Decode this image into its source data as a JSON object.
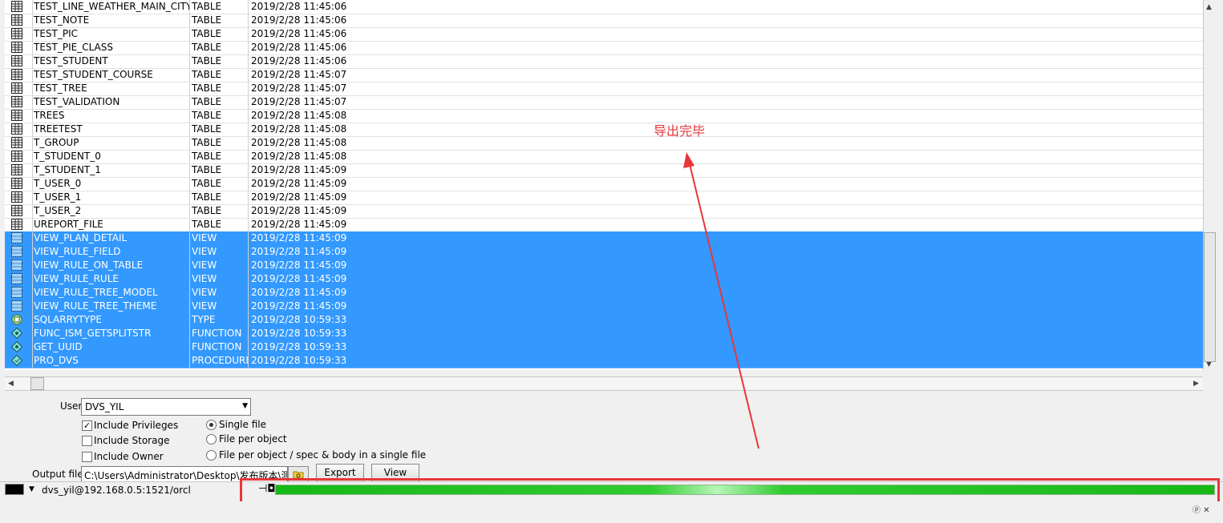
{
  "rows": [
    {
      "name": "TEST_LINE_WEATHER_MAIN_CITY",
      "type": "TABLE",
      "date": "2019/2/28 11:45:06",
      "icon": "table-icon",
      "selected": false
    },
    {
      "name": "TEST_NOTE",
      "type": "TABLE",
      "date": "2019/2/28 11:45:06",
      "icon": "table-icon",
      "selected": false
    },
    {
      "name": "TEST_PIC",
      "type": "TABLE",
      "date": "2019/2/28 11:45:06",
      "icon": "table-icon",
      "selected": false
    },
    {
      "name": "TEST_PIE_CLASS",
      "type": "TABLE",
      "date": "2019/2/28 11:45:06",
      "icon": "table-icon",
      "selected": false
    },
    {
      "name": "TEST_STUDENT",
      "type": "TABLE",
      "date": "2019/2/28 11:45:06",
      "icon": "table-icon",
      "selected": false
    },
    {
      "name": "TEST_STUDENT_COURSE",
      "type": "TABLE",
      "date": "2019/2/28 11:45:07",
      "icon": "table-icon",
      "selected": false
    },
    {
      "name": "TEST_TREE",
      "type": "TABLE",
      "date": "2019/2/28 11:45:07",
      "icon": "table-icon",
      "selected": false
    },
    {
      "name": "TEST_VALIDATION",
      "type": "TABLE",
      "date": "2019/2/28 11:45:07",
      "icon": "table-icon",
      "selected": false
    },
    {
      "name": "TREES",
      "type": "TABLE",
      "date": "2019/2/28 11:45:08",
      "icon": "table-icon",
      "selected": false
    },
    {
      "name": "TREETEST",
      "type": "TABLE",
      "date": "2019/2/28 11:45:08",
      "icon": "table-icon",
      "selected": false
    },
    {
      "name": "T_GROUP",
      "type": "TABLE",
      "date": "2019/2/28 11:45:08",
      "icon": "table-icon",
      "selected": false
    },
    {
      "name": "T_STUDENT_0",
      "type": "TABLE",
      "date": "2019/2/28 11:45:08",
      "icon": "table-icon",
      "selected": false
    },
    {
      "name": "T_STUDENT_1",
      "type": "TABLE",
      "date": "2019/2/28 11:45:09",
      "icon": "table-icon",
      "selected": false
    },
    {
      "name": "T_USER_0",
      "type": "TABLE",
      "date": "2019/2/28 11:45:09",
      "icon": "table-icon",
      "selected": false
    },
    {
      "name": "T_USER_1",
      "type": "TABLE",
      "date": "2019/2/28 11:45:09",
      "icon": "table-icon",
      "selected": false
    },
    {
      "name": "T_USER_2",
      "type": "TABLE",
      "date": "2019/2/28 11:45:09",
      "icon": "table-icon",
      "selected": false
    },
    {
      "name": "UREPORT_FILE",
      "type": "TABLE",
      "date": "2019/2/28 11:45:09",
      "icon": "table-icon",
      "selected": false
    },
    {
      "name": "VIEW_PLAN_DETAIL",
      "type": "VIEW",
      "date": "2019/2/28 11:45:09",
      "icon": "view-icon",
      "selected": true
    },
    {
      "name": "VIEW_RULE_FIELD",
      "type": "VIEW",
      "date": "2019/2/28 11:45:09",
      "icon": "view-icon",
      "selected": true
    },
    {
      "name": "VIEW_RULE_ON_TABLE",
      "type": "VIEW",
      "date": "2019/2/28 11:45:09",
      "icon": "view-icon",
      "selected": true
    },
    {
      "name": "VIEW_RULE_RULE",
      "type": "VIEW",
      "date": "2019/2/28 11:45:09",
      "icon": "view-icon",
      "selected": true
    },
    {
      "name": "VIEW_RULE_TREE_MODEL",
      "type": "VIEW",
      "date": "2019/2/28 11:45:09",
      "icon": "view-icon",
      "selected": true
    },
    {
      "name": "VIEW_RULE_TREE_THEME",
      "type": "VIEW",
      "date": "2019/2/28 11:45:09",
      "icon": "view-icon",
      "selected": true
    },
    {
      "name": "SQLARRYTYPE",
      "type": "TYPE",
      "date": "2019/2/28 10:59:33",
      "icon": "type-icon",
      "selected": true
    },
    {
      "name": "FUNC_ISM_GETSPLITSTR",
      "type": "FUNCTION",
      "date": "2019/2/28 10:59:33",
      "icon": "function-icon",
      "selected": true
    },
    {
      "name": "GET_UUID",
      "type": "FUNCTION",
      "date": "2019/2/28 10:59:33",
      "icon": "function-icon",
      "selected": true
    },
    {
      "name": "PRO_DVS",
      "type": "PROCEDURE",
      "date": "2019/2/28 10:59:33",
      "icon": "procedure-icon",
      "selected": true
    }
  ],
  "options": {
    "user_label": "User",
    "user_value": "DVS_YIL",
    "include_privileges": "Include Privileges",
    "include_privileges_checked": true,
    "include_storage": "Include Storage",
    "include_storage_checked": false,
    "include_owner": "Include Owner",
    "include_owner_checked": false,
    "single_file": "Single file",
    "file_per_object": "File per object",
    "file_per_object_spec": "File per object / spec & body in a single file",
    "selected_mode": "single_file",
    "output_file_label": "Output file",
    "output_file_value": "C:\\Users\\Administrator\\Desktop\\发布版本\\测试",
    "export_label": "Export",
    "view_label": "View"
  },
  "status": {
    "connection": "dvs_yil@192.168.0.5:1521/orcl",
    "progress_fraction": 1.0
  },
  "annotation": "导出完毕",
  "colors": {
    "selection": "#3399ff",
    "annotation": "#e8363a",
    "progress": "#22c422"
  }
}
